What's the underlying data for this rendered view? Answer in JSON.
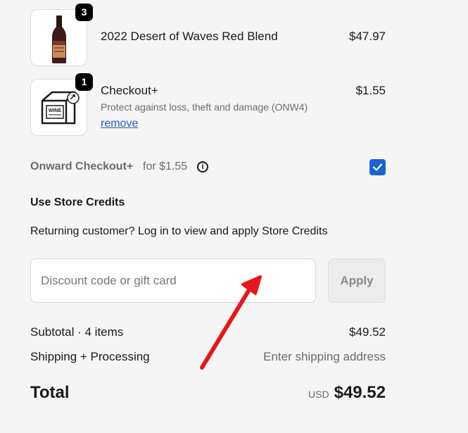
{
  "items": [
    {
      "name": "2022 Desert of Waves Red Blend",
      "price": "$47.97",
      "quantity": "3",
      "icon": "wine-bottle-icon"
    },
    {
      "name": "Checkout+",
      "price": "$1.55",
      "quantity": "1",
      "description": "Protect against loss, theft and damage (ONW4)",
      "action_label": "remove",
      "icon": "protection-box-icon",
      "box_text": "WINE"
    }
  ],
  "onward": {
    "label": "Onward Checkout+",
    "price_text": "for $1.55",
    "info_icon": "i",
    "checked": true
  },
  "store_credits": {
    "title": "Use Store Credits",
    "message": "Returning customer? Log in to view and apply Store Credits"
  },
  "discount": {
    "placeholder": "Discount code or gift card",
    "value": "",
    "apply_label": "Apply"
  },
  "summary": {
    "subtotal_label": "Subtotal · 4 items",
    "subtotal_value": "$49.52",
    "shipping_label": "Shipping + Processing",
    "shipping_value": "Enter shipping address",
    "total_label": "Total",
    "currency": "USD",
    "total_value": "$49.52"
  },
  "colors": {
    "accent": "#1864cc",
    "link": "#1f5fbf",
    "annotation_arrow": "#e8151b",
    "background": "#f5f5f5"
  }
}
